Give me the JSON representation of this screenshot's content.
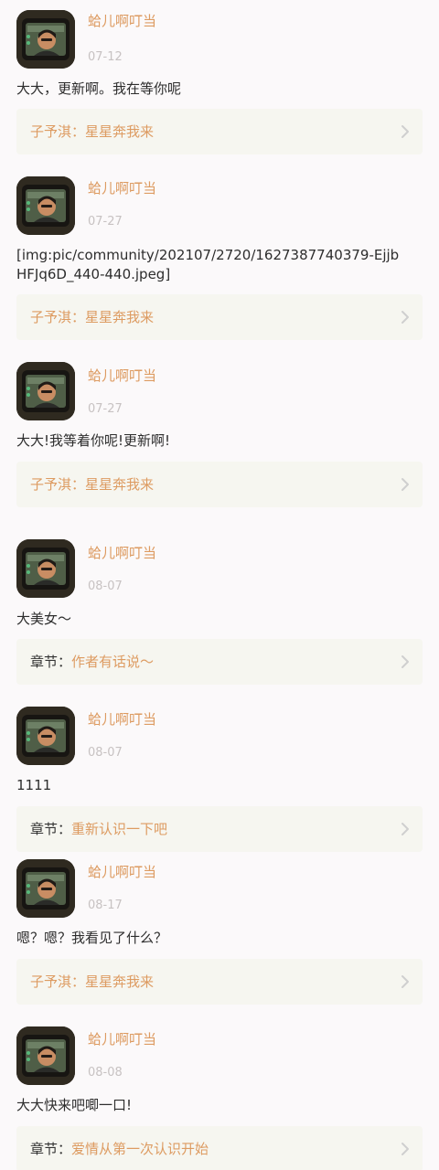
{
  "theme": {
    "background": "#fbf9fa",
    "accent": "#dd9b61",
    "date_color": "#c7c2c2",
    "ref_background": "#f6f6f0",
    "text_color": "#2d2d2d"
  },
  "comments": [
    {
      "user": "蛤儿啊叮当",
      "date": "07-12",
      "content": "大大，更新啊。我在等你呢",
      "reference": {
        "prefix": "子予淇：",
        "title": "星星奔我来",
        "icon": "chevron-right-icon"
      }
    },
    {
      "user": "蛤儿啊叮当",
      "date": "07-27",
      "content": "[img:pic/community/202107/2720/1627387740379-EjjbHFJq6D_440-440.jpeg]",
      "reference": {
        "prefix": "子予淇：",
        "title": "星星奔我来",
        "icon": "chevron-right-icon"
      }
    },
    {
      "user": "蛤儿啊叮当",
      "date": "07-27",
      "content": "大大!我等着你呢!更新啊!",
      "reference": {
        "prefix": "子予淇：",
        "title": "星星奔我来",
        "icon": "chevron-right-icon"
      }
    },
    {
      "user": "蛤儿啊叮当",
      "date": "08-07",
      "content": "大美女～",
      "reference": {
        "prefix": "章节：",
        "title": "作者有话说～",
        "icon": "chevron-right-icon"
      }
    },
    {
      "user": "蛤儿啊叮当",
      "date": "08-07",
      "content": "1111",
      "reference": {
        "prefix": "章节：",
        "title": "重新认识一下吧",
        "icon": "chevron-right-icon"
      }
    },
    {
      "user": "蛤儿啊叮当",
      "date": "08-17",
      "content": "嗯？嗯？我看见了什么？",
      "reference": {
        "prefix": "子予淇：",
        "title": "星星奔我来",
        "icon": "chevron-right-icon"
      }
    },
    {
      "user": "蛤儿啊叮当",
      "date": "08-08",
      "content": "大大快来吧唧一口!",
      "reference": {
        "prefix": "章节：",
        "title": "爱情从第一次认识开始",
        "icon": "chevron-right-icon"
      }
    }
  ]
}
